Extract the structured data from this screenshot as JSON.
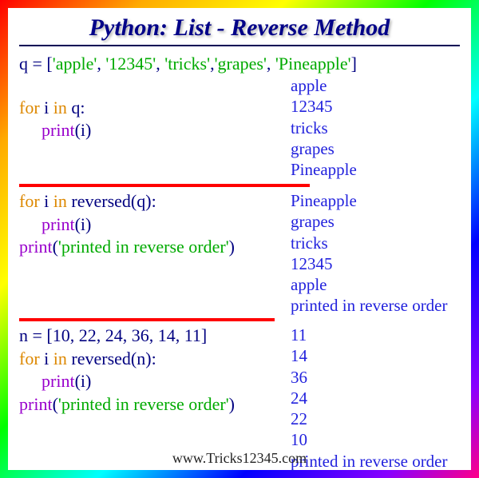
{
  "title": "Python: List - Reverse Method",
  "sec1": {
    "q_var": "q = [",
    "list_items": [
      "'apple'",
      "'12345'",
      "'tricks'",
      "'grapes'",
      "'Pineapple'"
    ],
    "close": "]",
    "for_kw": "for ",
    "i_var": "i ",
    "in_kw": "in",
    "q_loop": "  q:",
    "print_kw": "print",
    "print_arg": "(i)",
    "output": [
      "apple",
      "12345",
      "tricks",
      "grapes",
      "Pineapple"
    ]
  },
  "sec2": {
    "for_kw": "for ",
    "i_var": "i ",
    "in_kw": "in",
    "rev_call": "  reversed(q):",
    "print_kw": "print",
    "print_i": "(i)",
    "print_str_open": "(",
    "print_str": "'printed in reverse order'",
    "print_str_close": ")",
    "output": [
      "Pineapple",
      "grapes",
      "tricks",
      "12345",
      "apple",
      "printed in reverse order"
    ]
  },
  "sec3": {
    "n_var": "n = [",
    "n_items": "10, 22, 24, 36, 14, 11",
    "close": "]",
    "for_kw": "for ",
    "i_var": "i ",
    "in_kw": "in",
    "rev_call": "  reversed(n):",
    "print_kw": "print",
    "print_i": "(i)",
    "print_str_open": "(",
    "print_str": "'printed in reverse order'",
    "print_str_close": ")",
    "output": [
      "11",
      "14",
      "36",
      "24",
      "22",
      "10",
      "printed in reverse order"
    ]
  },
  "footer": "www.Tricks12345.com"
}
